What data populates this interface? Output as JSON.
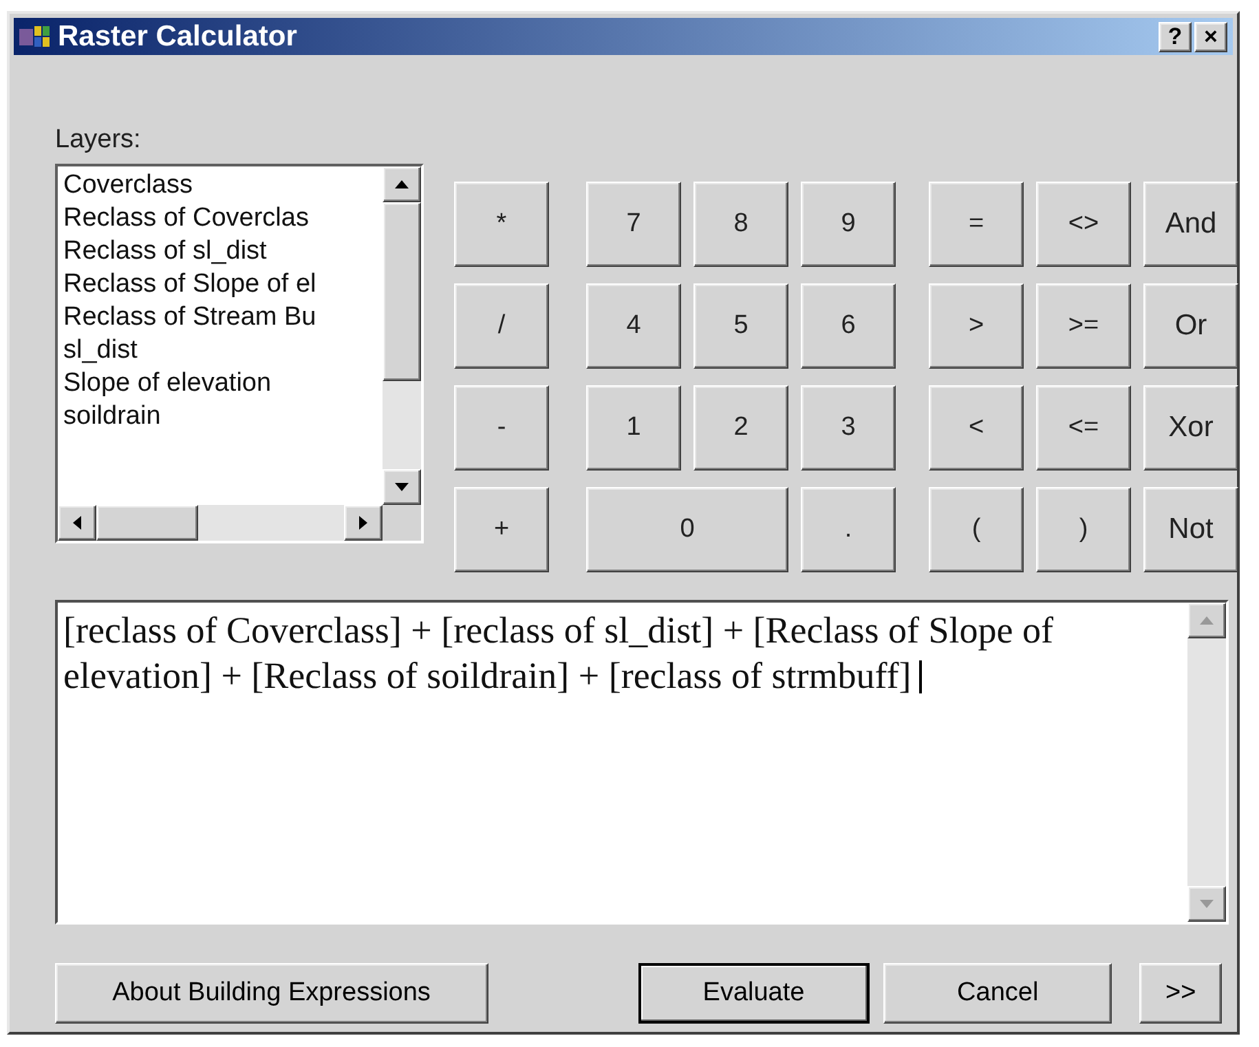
{
  "window": {
    "title": "Raster Calculator",
    "title_buttons": [
      "?",
      "×"
    ]
  },
  "layers": {
    "label": "Layers:",
    "items": [
      "Coverclass",
      "Reclass of Coverclas",
      "Reclass of sl_dist",
      "Reclass of Slope of el",
      "Reclass of Stream Bu",
      "sl_dist",
      "Slope of elevation",
      "soildrain"
    ]
  },
  "operators": [
    "*",
    "/",
    "-",
    "+"
  ],
  "digits": [
    [
      "7",
      "8",
      "9"
    ],
    [
      "4",
      "5",
      "6"
    ],
    [
      "1",
      "2",
      "3"
    ],
    [
      "0",
      "."
    ]
  ],
  "logic": [
    [
      "=",
      "<>",
      "And"
    ],
    [
      ">",
      ">=",
      "Or"
    ],
    [
      "<",
      "<=",
      "Xor"
    ],
    [
      "(",
      ")",
      "Not"
    ]
  ],
  "expression": "[reclass of Coverclass] + [reclass of sl_dist] + [Reclass of Slope of elevation] + [Reclass of soildrain] + [reclass of strmbuff]",
  "buttons": [
    {
      "label": "About Building Expressions",
      "default": false
    },
    {
      "label": "Evaluate",
      "default": true
    },
    {
      "label": "Cancel",
      "default": false
    },
    {
      "label": ">>",
      "default": false
    }
  ]
}
